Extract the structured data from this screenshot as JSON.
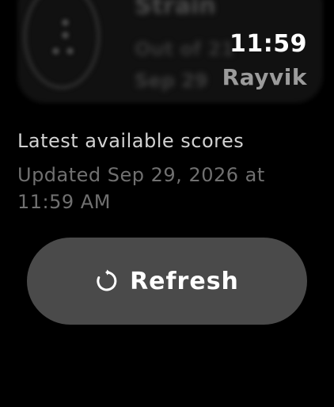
{
  "background_card": {
    "title": "Strain",
    "subtitle": "Out of 21",
    "date": "Sep 29"
  },
  "status": {
    "time": "11:59",
    "user": "Rayvik"
  },
  "main": {
    "heading": "Latest available scores",
    "updated": "Updated Sep 29, 2026 at 11:59 AM"
  },
  "actions": {
    "refresh_label": "Refresh",
    "refresh_icon": "refresh-icon"
  },
  "colors": {
    "background": "#000000",
    "button": "#4a4a4a",
    "muted_text": "#707070"
  }
}
